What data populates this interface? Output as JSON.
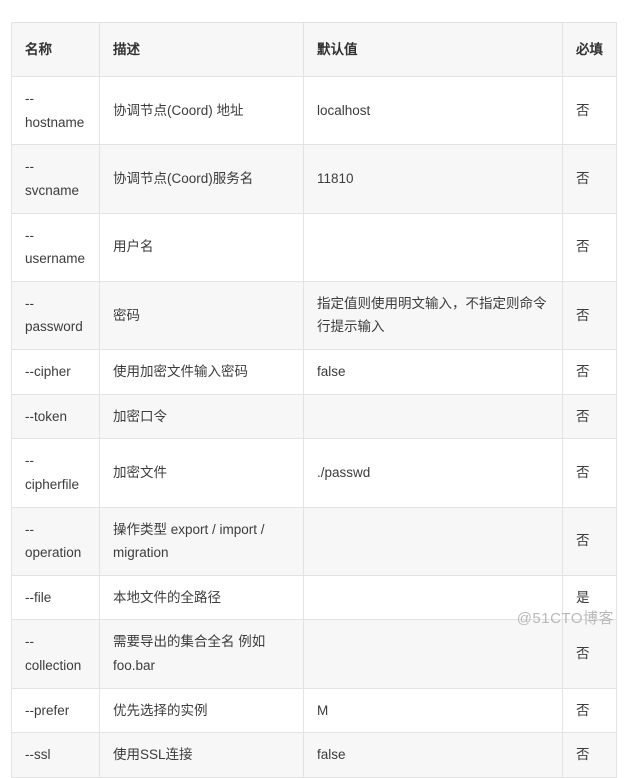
{
  "table": {
    "columns": [
      {
        "key": "name",
        "label": "名称"
      },
      {
        "key": "desc",
        "label": "描述"
      },
      {
        "key": "default",
        "label": "默认值"
      },
      {
        "key": "required",
        "label": "必填"
      }
    ],
    "rows": [
      {
        "name": "--hostname",
        "desc": "协调节点(Coord) 地址",
        "default": "localhost",
        "required": "否"
      },
      {
        "name": "--svcname",
        "desc": "协调节点(Coord)服务名",
        "default": "11810",
        "required": "否"
      },
      {
        "name": "--username",
        "desc": "用户名",
        "default": "",
        "required": "否"
      },
      {
        "name": "--password",
        "desc": "密码",
        "default": "指定值则使用明文输入，不指定则命令行提示输入",
        "required": "否"
      },
      {
        "name": "--cipher",
        "desc": "使用加密文件输入密码",
        "default": "false",
        "required": "否"
      },
      {
        "name": "--token",
        "desc": "加密口令",
        "default": "",
        "required": "否"
      },
      {
        "name": "--cipherfile",
        "desc": "加密文件",
        "default": "./passwd",
        "required": "否"
      },
      {
        "name": "--operation",
        "desc": "操作类型 export / import / migration",
        "default": "",
        "required": "否"
      },
      {
        "name": "--file",
        "desc": "本地文件的全路径",
        "default": "",
        "required": "是"
      },
      {
        "name": "--collection",
        "desc": "需要导出的集合全名 例如 foo.bar",
        "default": "",
        "required": "否"
      },
      {
        "name": "--prefer",
        "desc": "优先选择的实例",
        "default": "M",
        "required": "否"
      },
      {
        "name": "--ssl",
        "desc": "使用SSL连接",
        "default": "false",
        "required": "否"
      }
    ]
  },
  "watermark": {
    "text": "@51CTO博客"
  },
  "colors": {
    "border": "#e3e3e3",
    "stripe": "#f7f7f7",
    "header_bg": "#f7f7f7",
    "text": "#3c3c3c",
    "watermark": "#b9b9b9"
  }
}
